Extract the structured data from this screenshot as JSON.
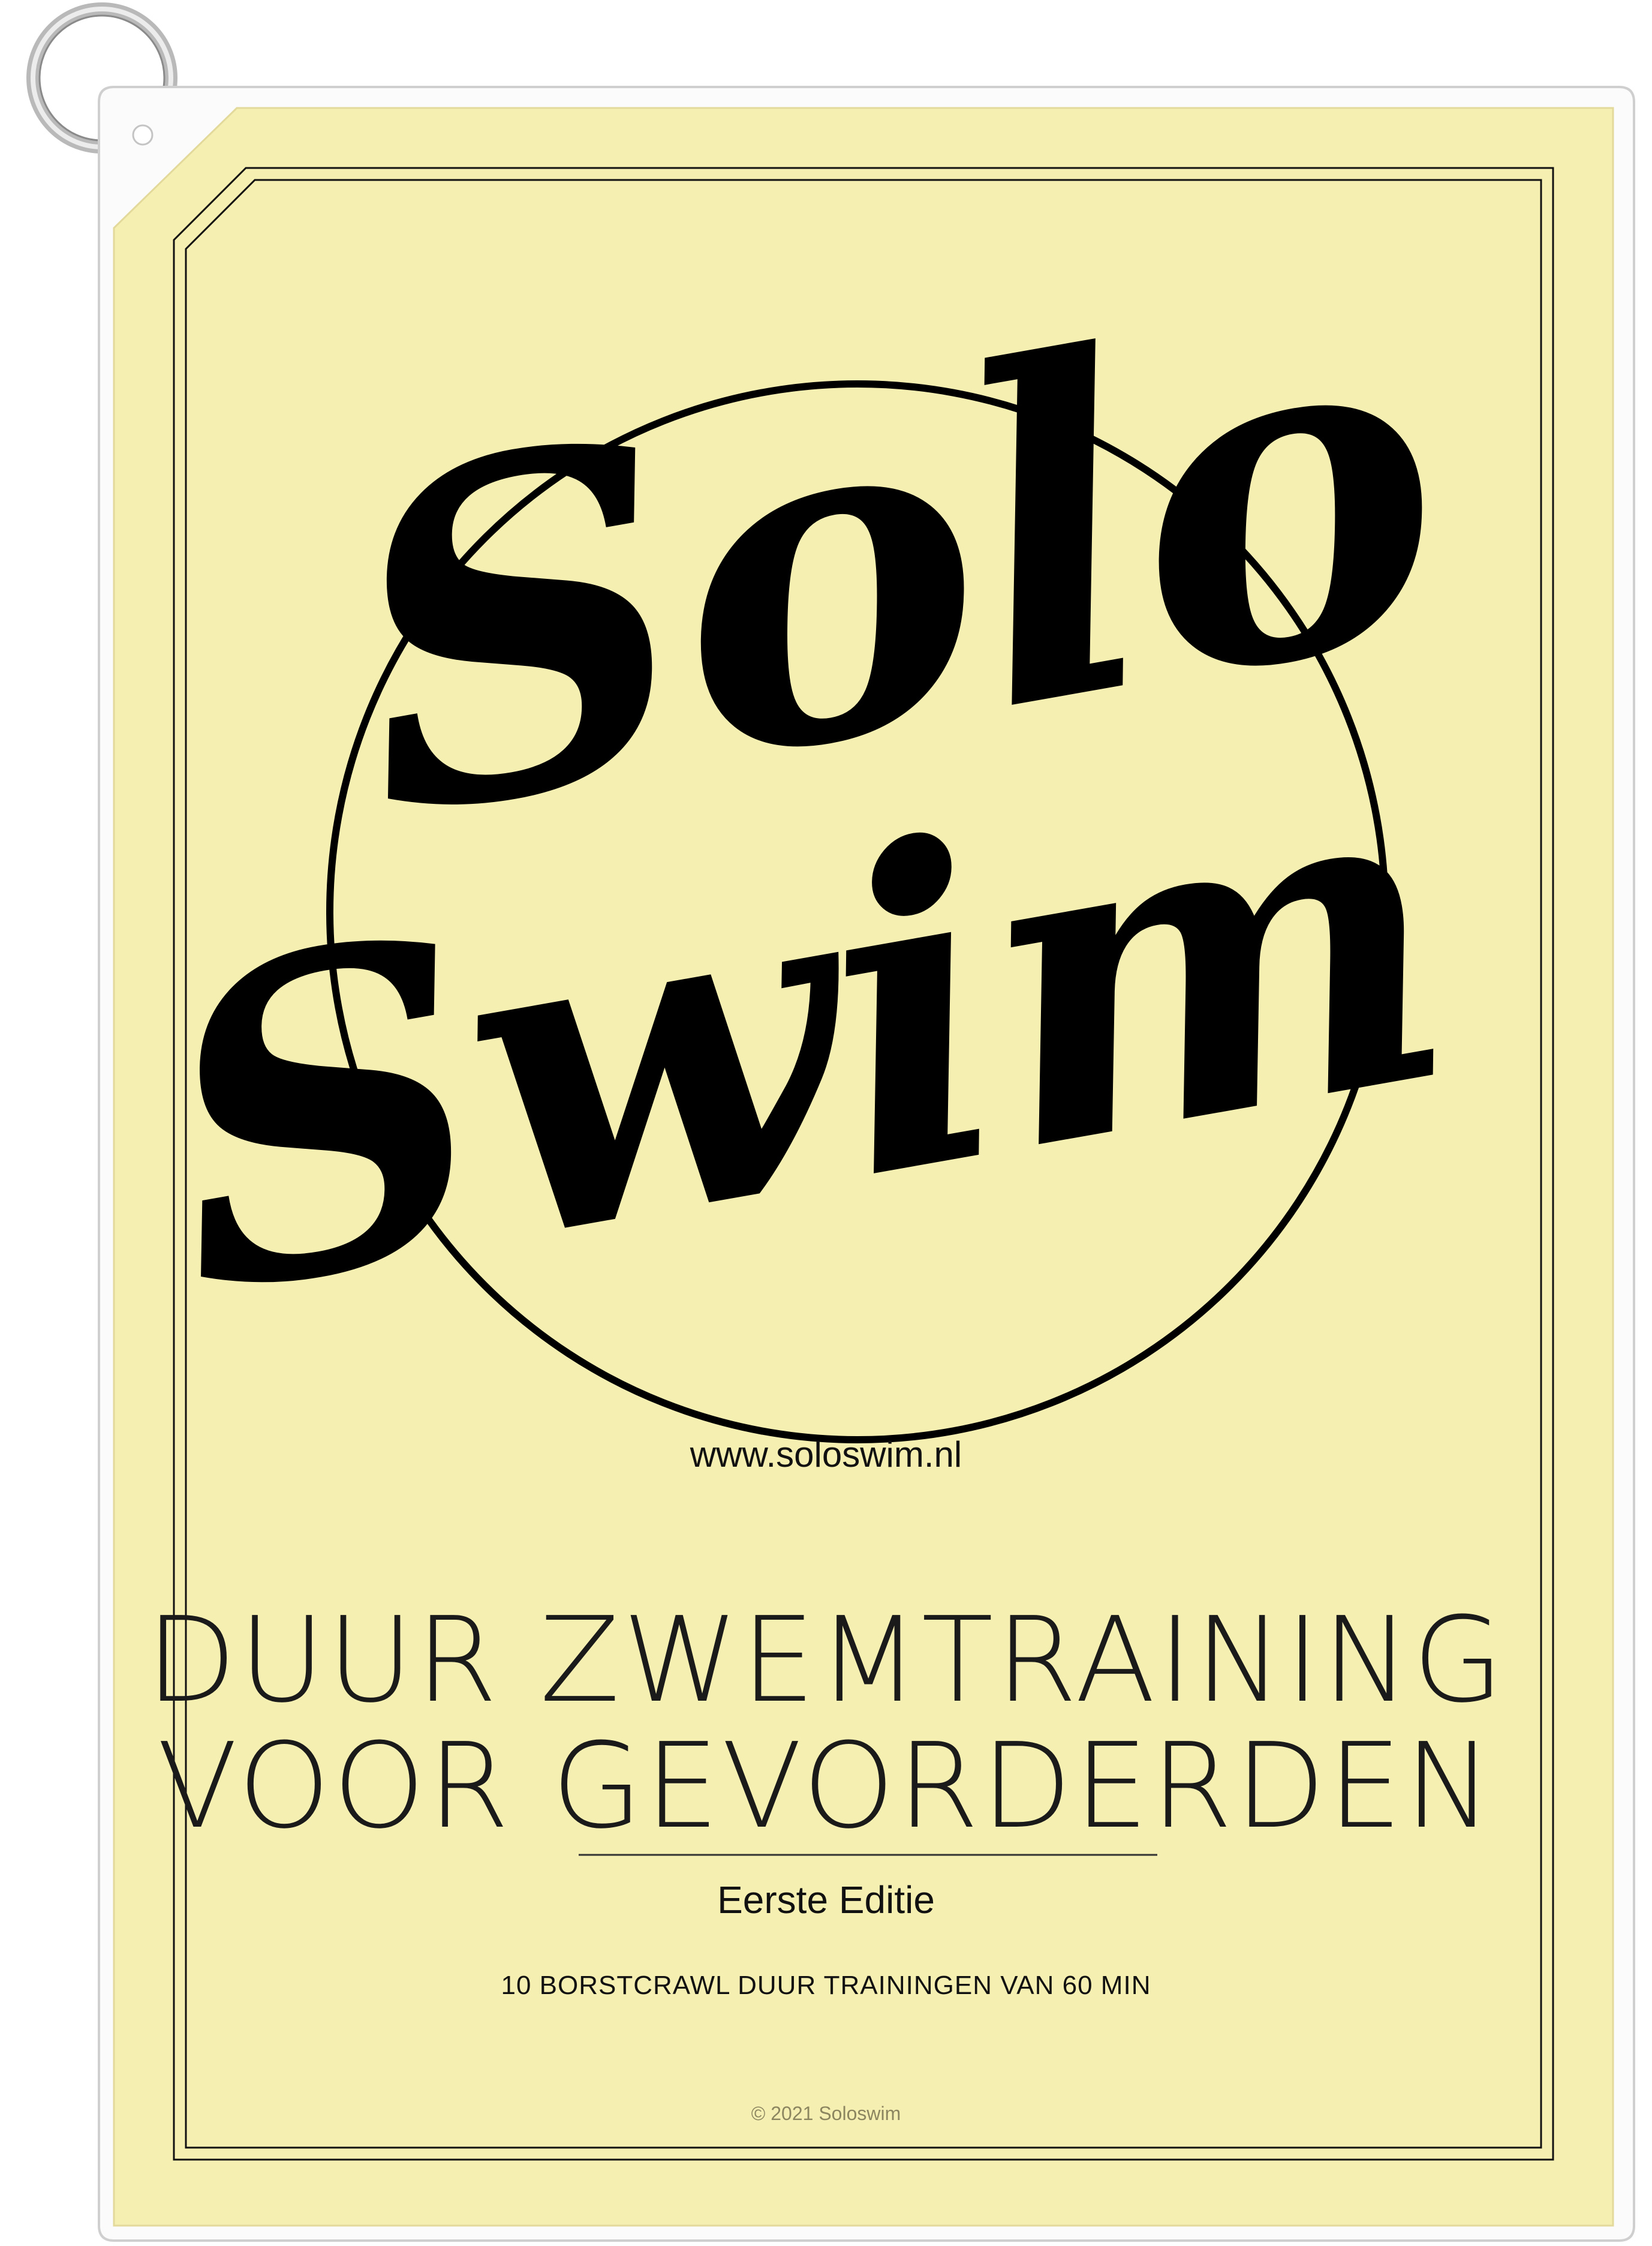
{
  "cover": {
    "logo_line1": "Solo",
    "logo_line2": "Swim",
    "website": "www.soloswim.nl",
    "title_line1": "DUUR ZWEMTRAINING",
    "title_line2": "VOOR GEVORDERDEN",
    "edition": "Eerste Editie",
    "subtitle": "10 BORSTCRAWL DUUR TRAININGEN VAN 60 MIN",
    "copyright": "© 2021 Soloswim"
  },
  "colors": {
    "card_background": "#f6efb2",
    "ink": "#000000",
    "sleeve_edge": "#d6d6d6",
    "copyright_text": "#8c8660"
  }
}
